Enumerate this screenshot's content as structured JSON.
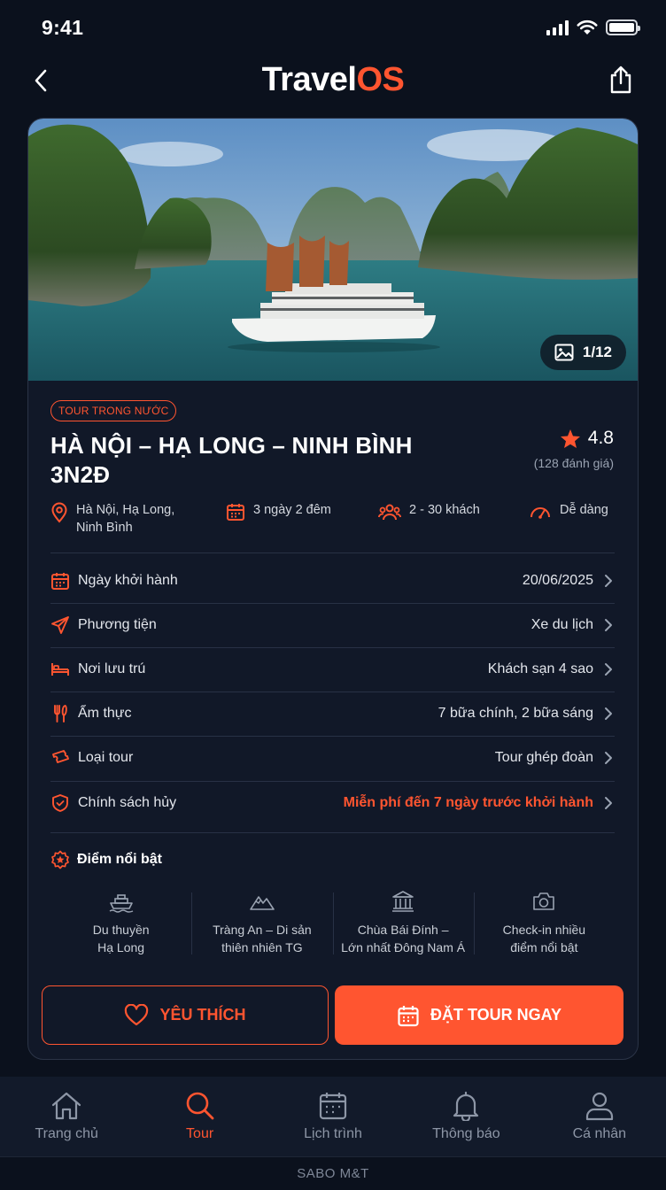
{
  "status": {
    "time": "9:41"
  },
  "header": {
    "logo_part1": "Travel",
    "logo_part2": "OS"
  },
  "hero": {
    "photo_counter": "1/12"
  },
  "tour": {
    "badge": "TOUR TRONG NƯỚC",
    "title_line1": "HÀ NỘI – HẠ LONG – NINH BÌNH",
    "title_line2": "3N2Đ",
    "rating": "4.8",
    "rating_count": "(128 đánh giá)",
    "meta": {
      "location_line1": "Hà Nội, Hạ Long,",
      "location_line2": "Ninh Bình",
      "duration": "3 ngày 2 đêm",
      "group_size": "2 - 30 khách",
      "difficulty": "Dễ dàng"
    }
  },
  "details": [
    {
      "label": "Ngày khởi hành",
      "value": "20/06/2025",
      "icon": "calendar-icon"
    },
    {
      "label": "Phương tiện",
      "value": "Xe du lịch",
      "icon": "plane-icon"
    },
    {
      "label": "Nơi lưu trú",
      "value": "Khách sạn 4 sao",
      "icon": "bed-icon"
    },
    {
      "label": "Ẩm thực",
      "value": "7 bữa chính, 2 bữa sáng",
      "icon": "cutlery-icon"
    },
    {
      "label": "Loại tour",
      "value": "Tour ghép đoàn",
      "icon": "ticket-icon"
    },
    {
      "label": "Chính sách hủy",
      "value": "Miễn phí đến 7 ngày trước khởi hành",
      "icon": "shield-icon"
    }
  ],
  "highlights": {
    "title": "Điểm nổi bật",
    "items": [
      {
        "line1": "Du thuyền",
        "line2": "Hạ Long",
        "icon": "boat-icon"
      },
      {
        "line1": "Tràng An – Di sản",
        "line2": "thiên nhiên TG",
        "icon": "mountain-icon"
      },
      {
        "line1": "Chùa Bái Đính –",
        "line2": "Lớn nhất Đông Nam Á",
        "icon": "temple-icon"
      },
      {
        "line1": "Check-in nhiều",
        "line2": "điểm nổi bật",
        "icon": "camera-icon"
      }
    ]
  },
  "actions": {
    "favorite": "YÊU THÍCH",
    "book": "ĐẶT TOUR NGAY"
  },
  "nav": {
    "items": [
      {
        "label": "Trang chủ",
        "icon": "home-icon"
      },
      {
        "label": "Tour",
        "icon": "search-icon"
      },
      {
        "label": "Lịch trình",
        "icon": "calendar-icon"
      },
      {
        "label": "Thông báo",
        "icon": "bell-icon"
      },
      {
        "label": "Cá nhân",
        "icon": "user-icon"
      }
    ],
    "active_index": 1
  },
  "footer": "SABO M&T",
  "colors": {
    "accent": "#ff5530",
    "background": "#0b111d",
    "card": "#111828"
  }
}
